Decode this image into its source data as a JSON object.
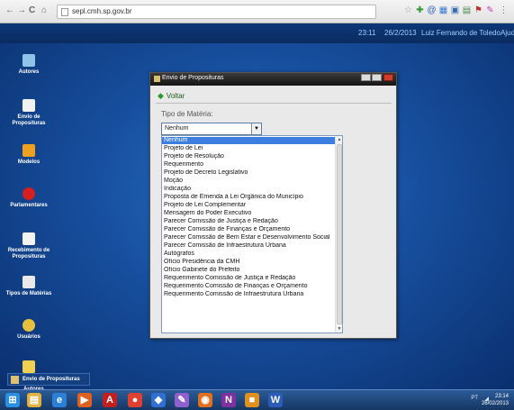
{
  "browser": {
    "url": "sepl.cmh.sp.gov.br",
    "nav": {
      "back": "←",
      "forward": "→",
      "reload": "C",
      "home": "⌂"
    },
    "extensions": [
      "star-icon",
      "plus-icon",
      "at-icon",
      "translate-icon",
      "bookmark-icon",
      "addon-icon",
      "pen-icon",
      "menu-icon"
    ]
  },
  "topstrip": {
    "time": "23:11",
    "date": "26/2/2013",
    "user": "Luiz Fernando de Toledo",
    "help": "Ajud"
  },
  "desktop_icons": [
    {
      "label": "Autores",
      "color": "#8fc3e8"
    },
    {
      "label": "Envio de Proposituras",
      "color": "#f2f2f2"
    },
    {
      "label": "Modelos",
      "color": "#f0a020"
    },
    {
      "label": "Parlamentares",
      "color": "#d62020"
    },
    {
      "label": "Recebimento de Proposituras",
      "color": "#f2f2f2"
    },
    {
      "label": "Tipos de Matérias",
      "color": "#e9e9e9"
    },
    {
      "label": "Usuários",
      "color": "#e8c040"
    },
    {
      "label": "Sair",
      "color": "#f0d050"
    }
  ],
  "dialog": {
    "title": "Envio de Proposituras",
    "back_label": "Voltar",
    "field_label": "Tipo de Matéria:",
    "selected_value": "Nenhum",
    "options": [
      "Nenhum",
      "Projeto de Lei",
      "Projeto de Resolução",
      "Requerimento",
      "Projeto de Decreto Legislativo",
      "Moção",
      "Indicação",
      "Proposta de Emenda à Lei Orgânica do Município",
      "Projeto de Lei Complementar",
      "Mensagem do Poder Executivo",
      "Parecer Comissão de Justiça e Redação",
      "Parecer Comissão de Finanças e Orçamento",
      "Parecer Comissão de Bem Estar e Desenvolvimento Social",
      "Parecer Comissão de Infraestrutura Urbana",
      "Autógrafos",
      "Ofício Presidência da CMH",
      "Ofício Gabinete do Prefeito",
      "Requerimento Comissão de Justiça e Redação",
      "Requerimento Comissão de Finanças e Orçamento",
      "Requerimento Comissão de Infraestrutura Urbana"
    ]
  },
  "taskbar_window": {
    "label": "Envio de Proposituras",
    "below_label": "Autores"
  },
  "taskbar": {
    "apps": [
      {
        "name": "windows-start-icon",
        "glyph": "⊞",
        "color": "#2a8fe0"
      },
      {
        "name": "file-explorer-icon",
        "glyph": "▤",
        "color": "#e0b040"
      },
      {
        "name": "internet-explorer-icon",
        "glyph": "e",
        "color": "#2a7fd6"
      },
      {
        "name": "media-player-icon",
        "glyph": "▶",
        "color": "#e06020"
      },
      {
        "name": "adobe-reader-icon",
        "glyph": "A",
        "color": "#c02020"
      },
      {
        "name": "chrome-icon",
        "glyph": "●",
        "color": "#e04030"
      },
      {
        "name": "app-blue-icon",
        "glyph": "◆",
        "color": "#3070d0"
      },
      {
        "name": "paint-icon",
        "glyph": "✎",
        "color": "#8f5fd0"
      },
      {
        "name": "firefox-icon",
        "glyph": "◉",
        "color": "#e07020"
      },
      {
        "name": "onenote-icon",
        "glyph": "N",
        "color": "#8030a0"
      },
      {
        "name": "app-orange-icon",
        "glyph": "■",
        "color": "#e09020"
      },
      {
        "name": "word-icon",
        "glyph": "W",
        "color": "#2a5cb8"
      }
    ],
    "tray_lang": "PT",
    "clock_time": "23:14",
    "clock_date": "26/02/2013"
  }
}
